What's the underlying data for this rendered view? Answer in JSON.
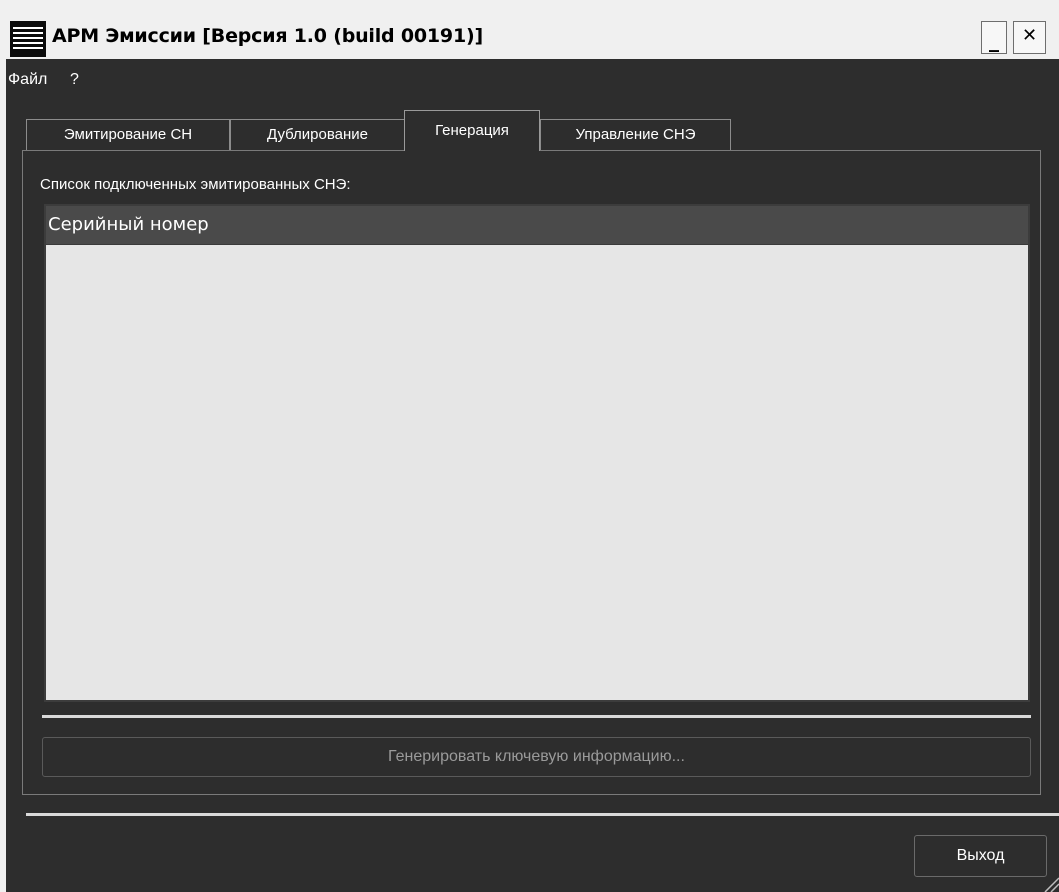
{
  "window": {
    "title": "АРМ Эмиссии [Версия 1.0 (build 00191)]",
    "minimize_label": "_",
    "close_label": "✕"
  },
  "menu": {
    "items": [
      {
        "label": "Файл"
      },
      {
        "label": "?"
      }
    ]
  },
  "tabs": [
    {
      "label": "Эмитирование СН",
      "active": false
    },
    {
      "label": "Дублирование",
      "active": false
    },
    {
      "label": "Генерация",
      "active": true
    },
    {
      "label": "Управление СНЭ",
      "active": false
    }
  ],
  "generation": {
    "list_label": "Список подключенных эмитированных СНЭ:",
    "table": {
      "columns": [
        "Серийный номер"
      ],
      "rows": []
    },
    "generate_button": {
      "label": "Генерировать ключевую информацию...",
      "enabled": false
    }
  },
  "footer": {
    "exit_button": {
      "label": "Выход"
    }
  },
  "icons": {
    "app": "menu-lines-icon",
    "resize": "resize-grip-icon"
  },
  "colors": {
    "window_bg": "#2d2d2d",
    "table_bg": "#e6e6e6",
    "table_header_bg": "#4a4a4a",
    "disabled_text": "#9a9a9a"
  }
}
